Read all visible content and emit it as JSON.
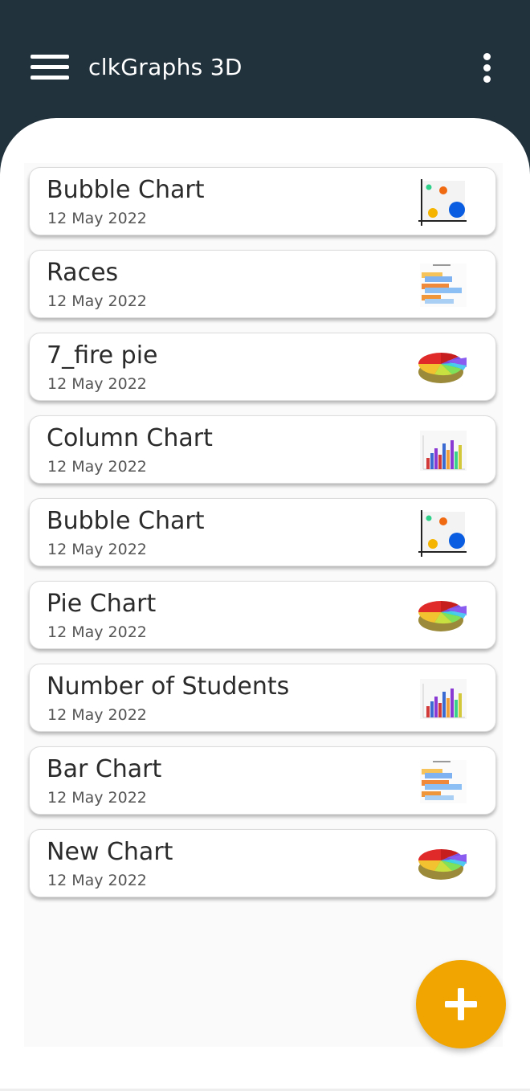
{
  "appbar": {
    "title": "clkGraphs 3D",
    "menu_icon": "hamburger-menu-icon",
    "overflow_icon": "more-vert-icon",
    "background": "#22323d"
  },
  "charts": [
    {
      "title": "Bubble Chart",
      "date": "12 May 2022",
      "icon": "bubble-chart-icon"
    },
    {
      "title": "Races",
      "date": "12 May 2022",
      "icon": "bar-chart-icon"
    },
    {
      "title": "7_fire pie",
      "date": "12 May 2022",
      "icon": "pie-chart-icon"
    },
    {
      "title": "Column Chart",
      "date": "12 May 2022",
      "icon": "column-chart-icon"
    },
    {
      "title": "Bubble Chart",
      "date": "12 May 2022",
      "icon": "bubble-chart-icon"
    },
    {
      "title": "Pie Chart",
      "date": "12 May 2022",
      "icon": "pie-chart-icon"
    },
    {
      "title": "Number of Students",
      "date": "12 May 2022",
      "icon": "column-chart-icon"
    },
    {
      "title": "Bar Chart",
      "date": "12 May 2022",
      "icon": "bar-chart-icon"
    },
    {
      "title": "New Chart",
      "date": "12 May 2022",
      "icon": "pie-chart-icon"
    }
  ],
  "fab": {
    "icon": "plus-icon",
    "color": "#f0a500"
  }
}
